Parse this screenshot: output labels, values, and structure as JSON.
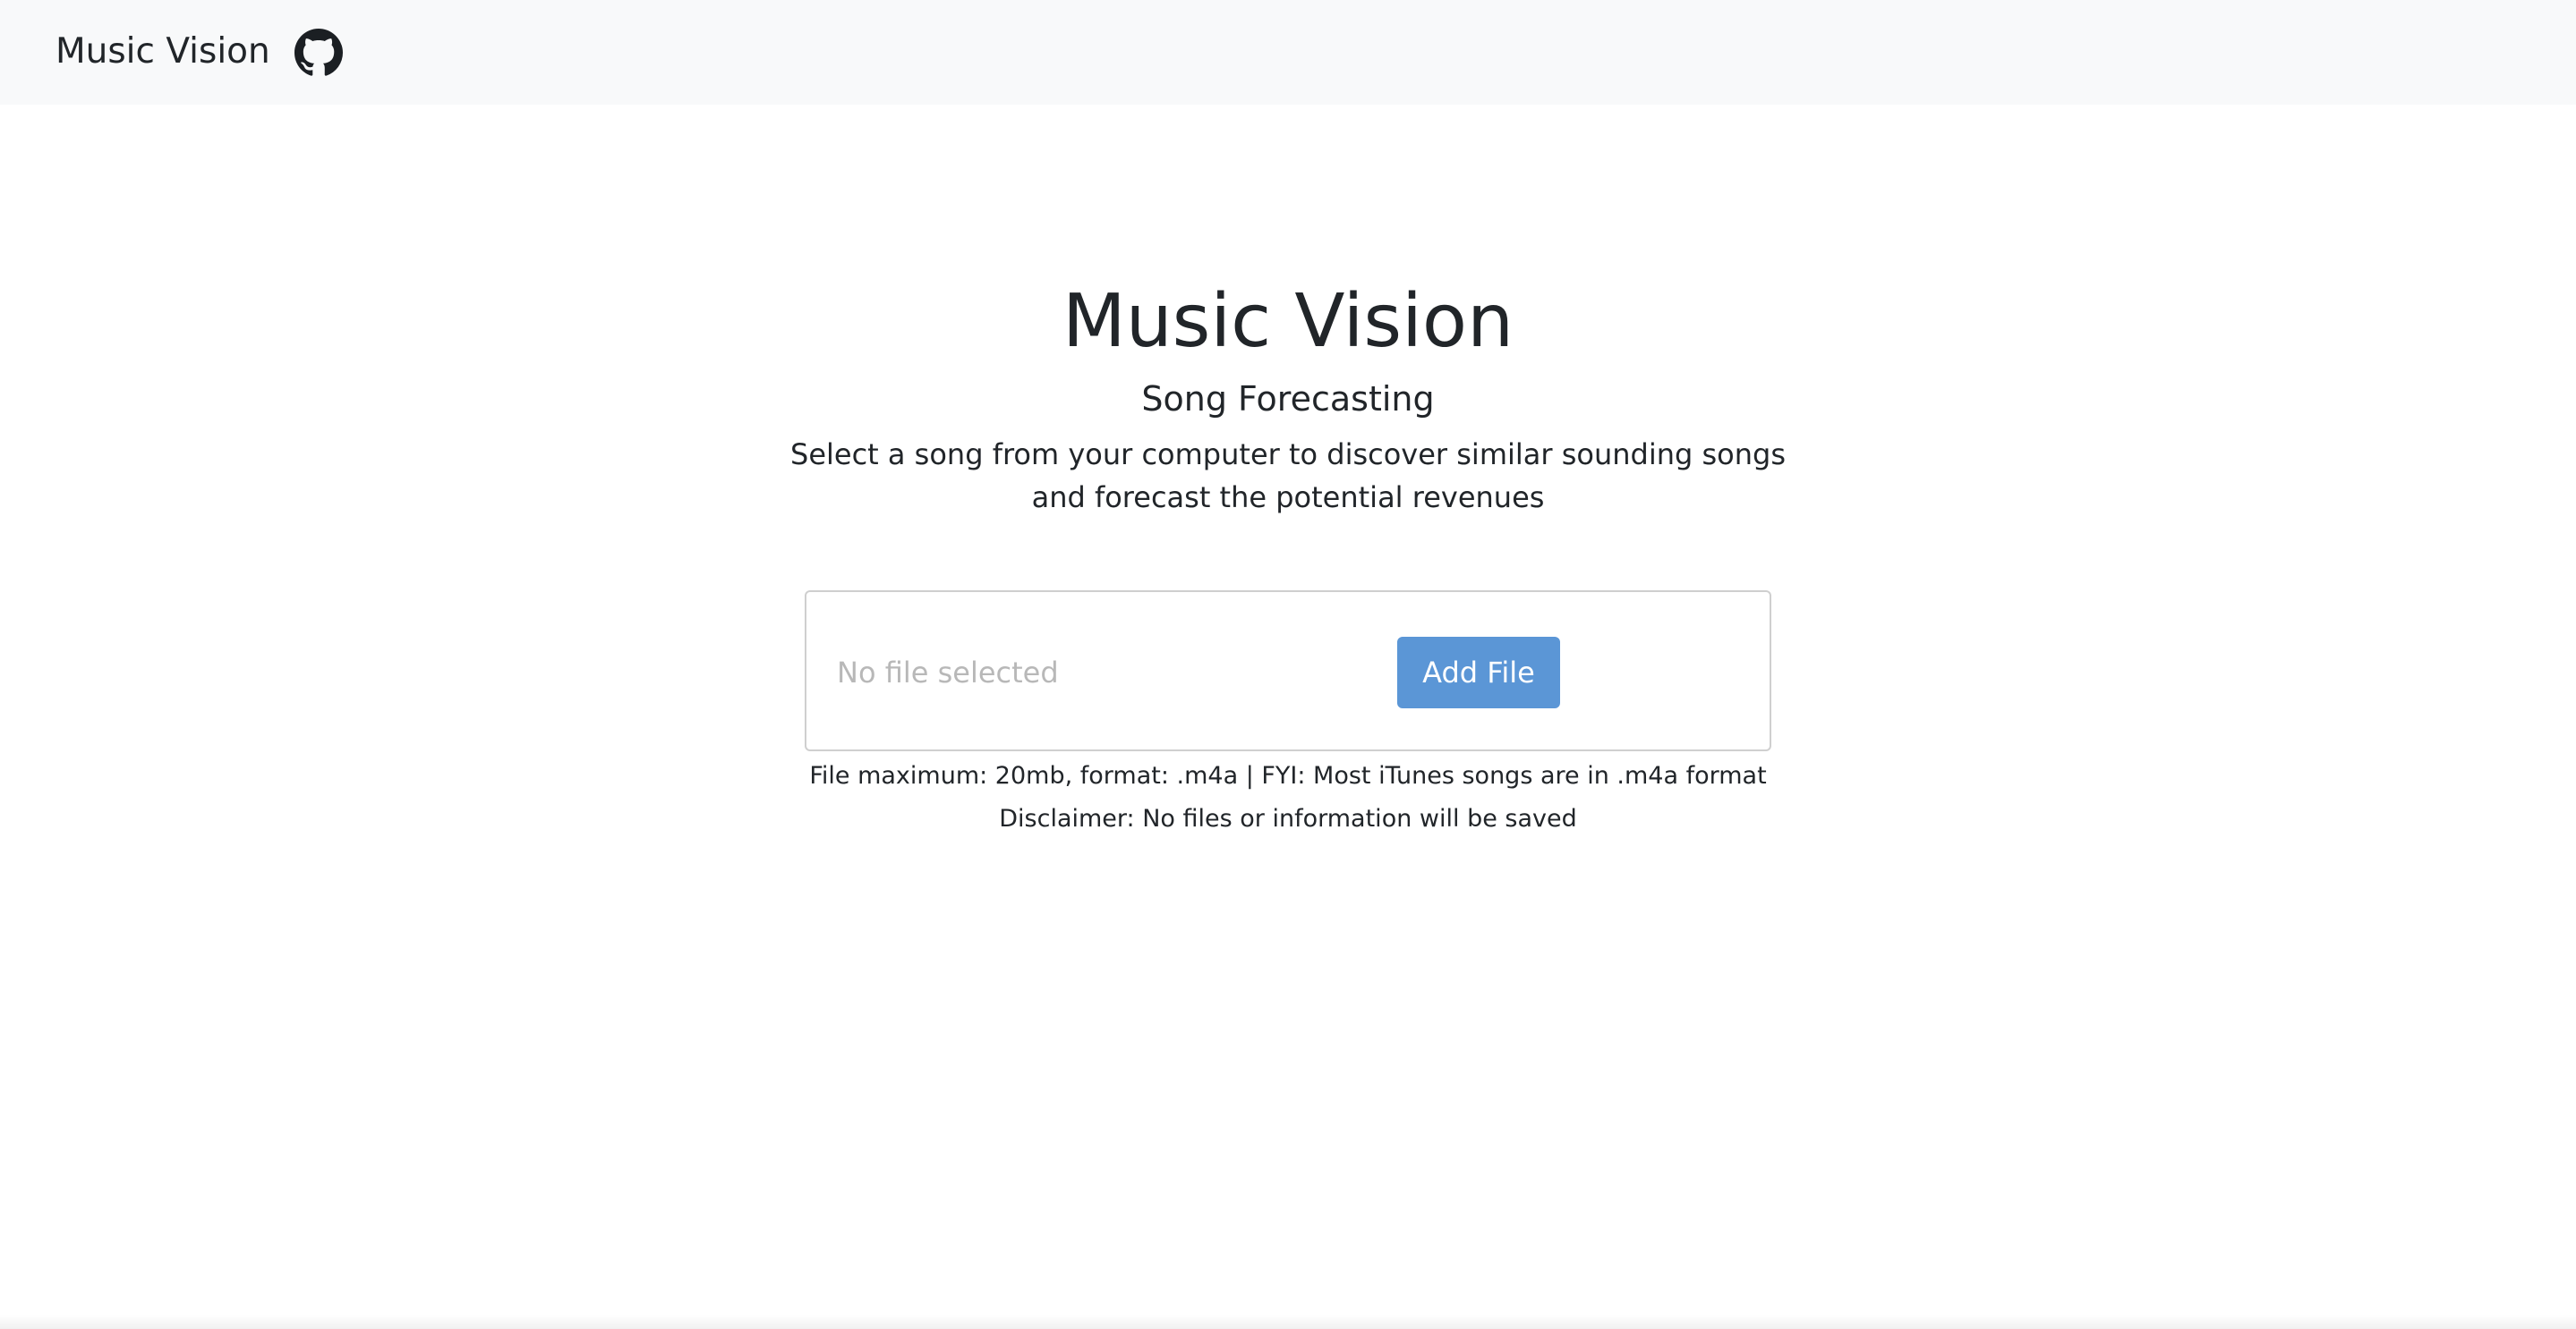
{
  "navbar": {
    "brand": "Music Vision",
    "github_icon": "github-icon"
  },
  "hero": {
    "title": "Music Vision",
    "subtitle": "Song Forecasting",
    "description": "Select a song from your computer to discover similar sounding songs and forecast the potential revenues"
  },
  "uploader": {
    "status": "No file selected",
    "add_button_label": "Add File",
    "accent_color": "#5b96d6"
  },
  "notes": {
    "limits": "File maximum: 20mb, format: .m4a | FYI: Most iTunes songs are in .m4a format",
    "disclaimer": "Disclaimer: No files or information will be saved"
  }
}
